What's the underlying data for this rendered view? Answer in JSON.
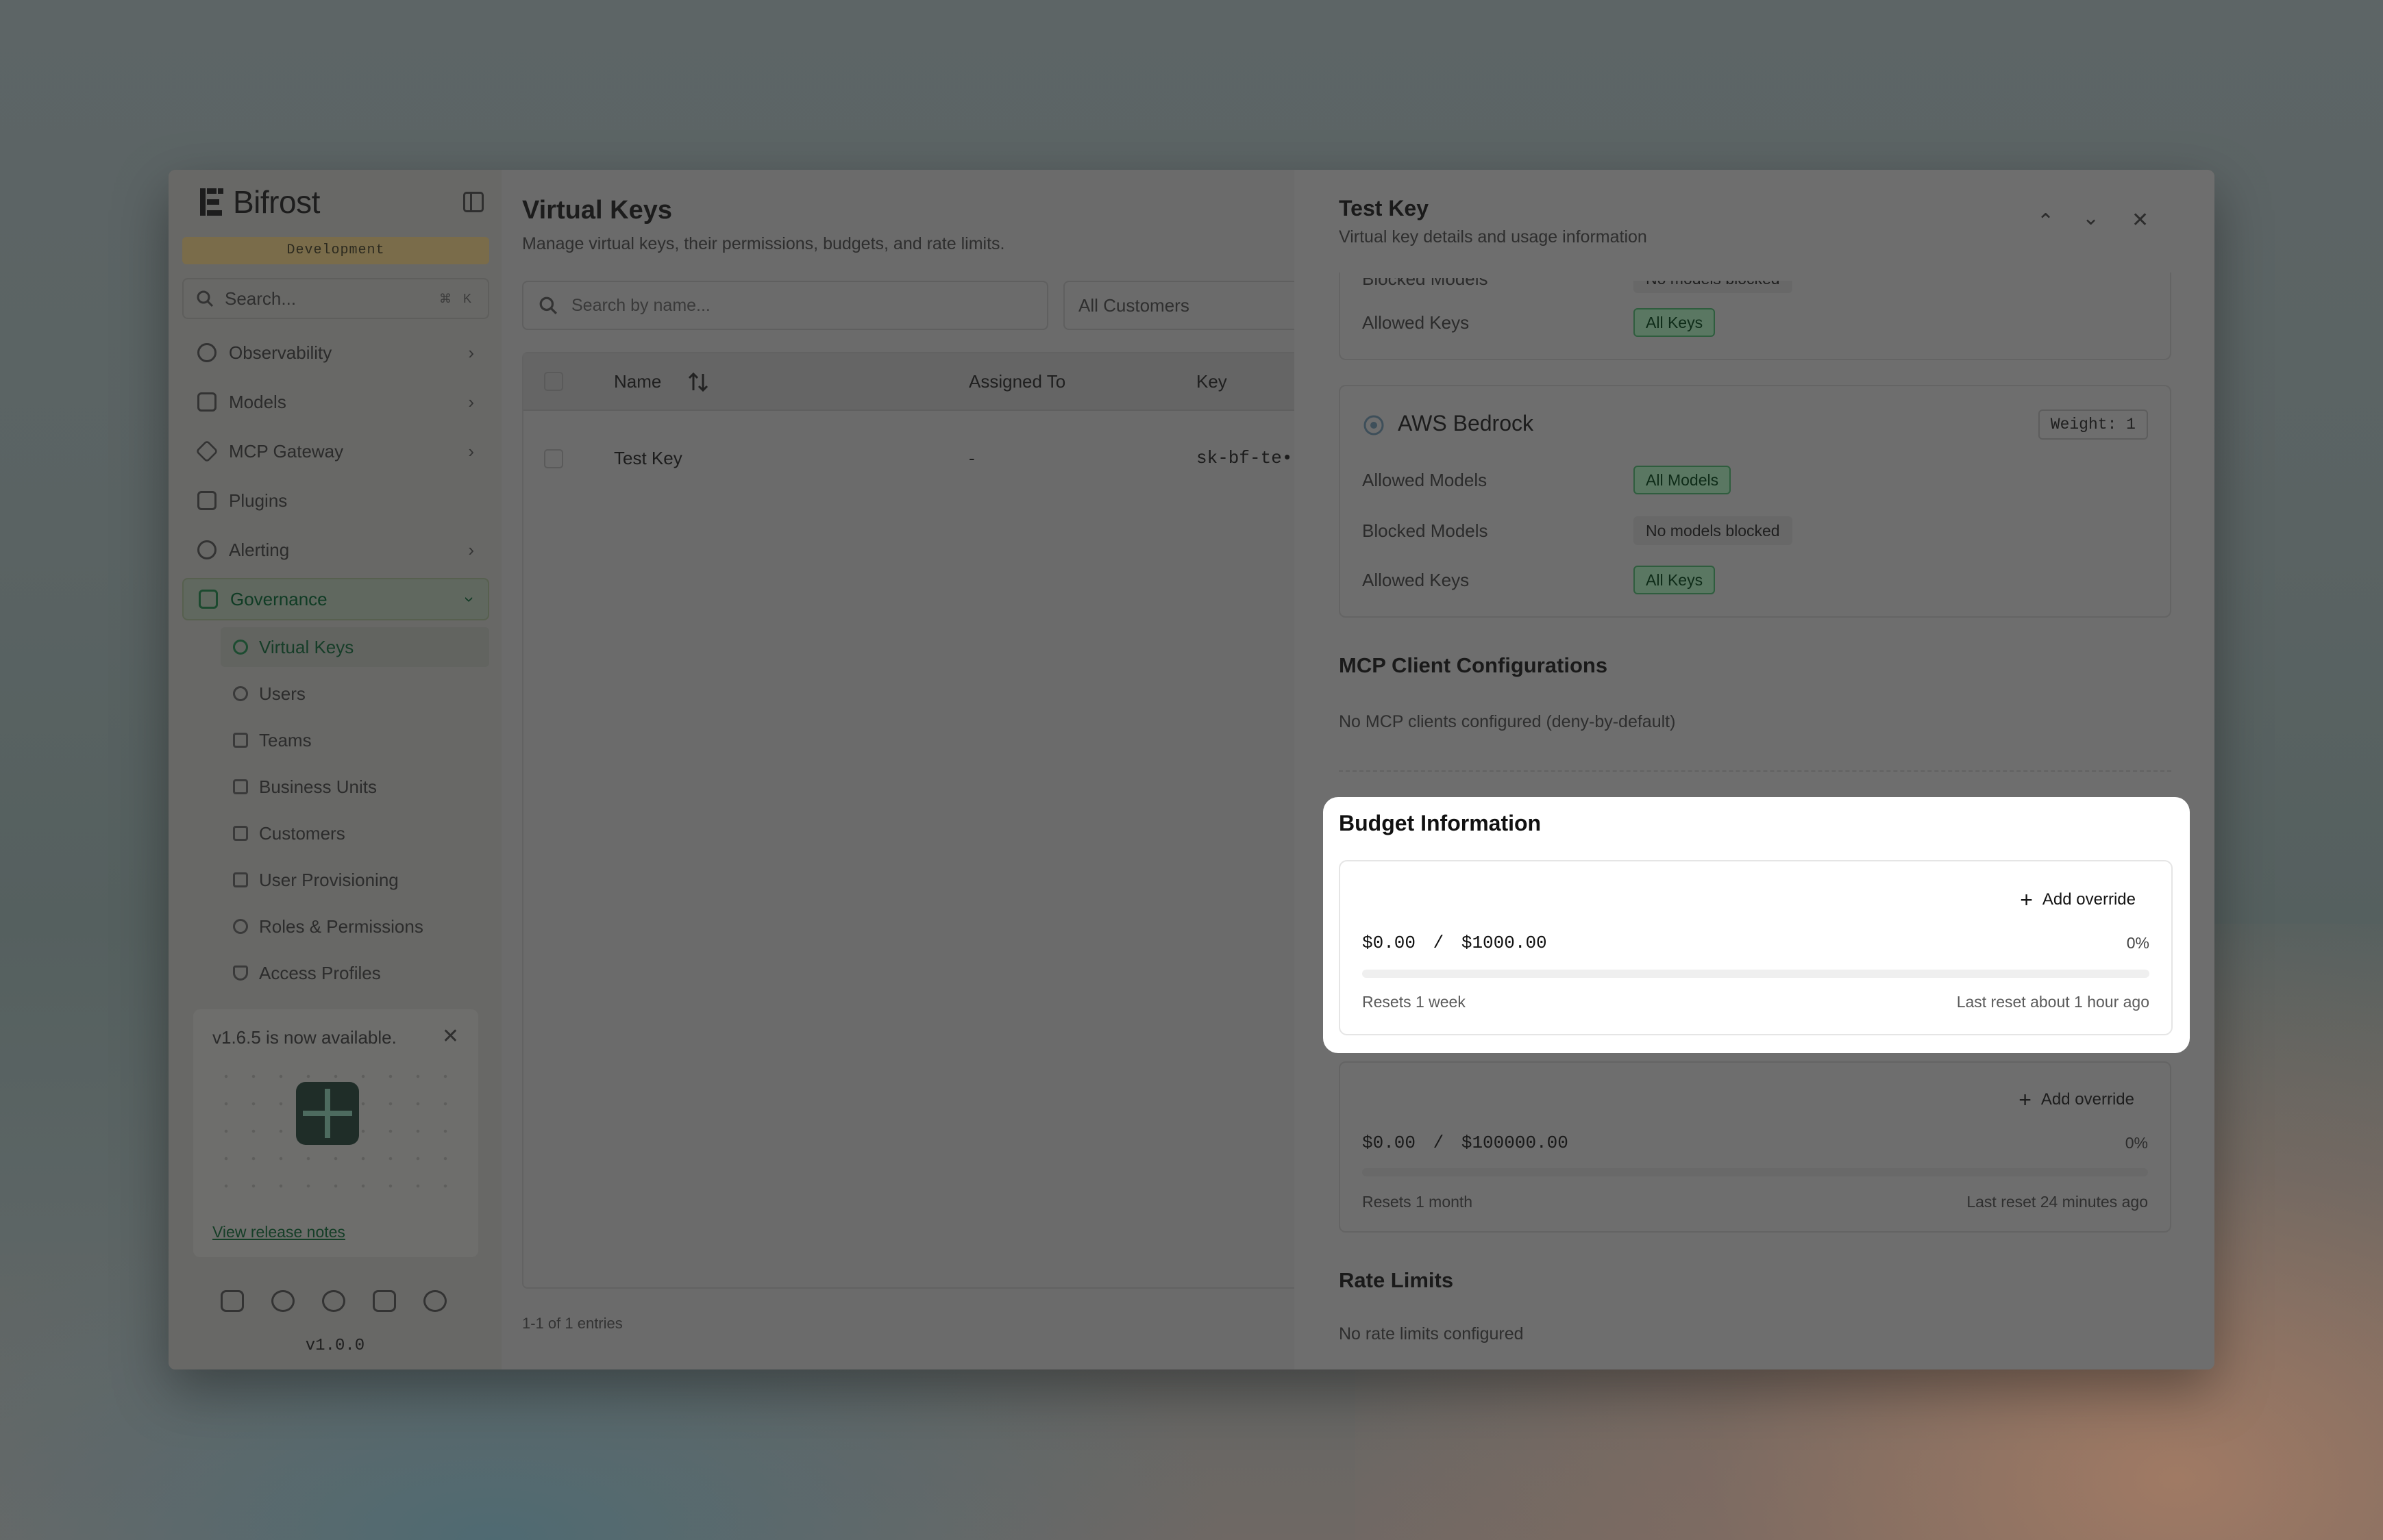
{
  "app": {
    "name": "Bifrost",
    "environment": "Development",
    "version": "v1.0.0"
  },
  "sidebar": {
    "search_placeholder": "Search...",
    "search_shortcut": "⌘ K",
    "items": [
      {
        "label": "Observability",
        "icon": "telescope-icon"
      },
      {
        "label": "Models",
        "icon": "cube-icon"
      },
      {
        "label": "MCP Gateway",
        "icon": "mcp-icon"
      },
      {
        "label": "Plugins",
        "icon": "puzzle-icon"
      },
      {
        "label": "Alerting",
        "icon": "siren-icon"
      },
      {
        "label": "Governance",
        "icon": "landmark-icon"
      }
    ],
    "governance_items": [
      {
        "label": "Virtual Keys",
        "icon": "key-icon"
      },
      {
        "label": "Users",
        "icon": "users-icon"
      },
      {
        "label": "Teams",
        "icon": "teams-icon"
      },
      {
        "label": "Business Units",
        "icon": "building-icon"
      },
      {
        "label": "Customers",
        "icon": "customers-icon"
      },
      {
        "label": "User Provisioning",
        "icon": "provisioning-icon"
      },
      {
        "label": "Roles & Permissions",
        "icon": "roles-icon"
      },
      {
        "label": "Access Profiles",
        "icon": "shield-icon"
      }
    ],
    "update_card": {
      "title": "v1.6.5 is now available.",
      "link": "View release notes"
    }
  },
  "main": {
    "title": "Virtual Keys",
    "subtitle": "Manage virtual keys, their permissions, budgets, and rate limits.",
    "search_placeholder": "Search by name...",
    "customer_filter": "All Customers",
    "columns": {
      "name": "Name",
      "assigned_to": "Assigned To",
      "key": "Key"
    },
    "rows": [
      {
        "name": "Test Key",
        "assigned_to": "-",
        "key": "sk-bf-te•"
      }
    ],
    "entries": "1-1 of 1 entries"
  },
  "drawer": {
    "title": "Test Key",
    "subtitle": "Virtual key details and usage information",
    "top_card": {
      "blocked_models_label": "Blocked Models",
      "blocked_models_value": "No models blocked",
      "allowed_keys_label": "Allowed Keys",
      "allowed_keys_value": "All Keys"
    },
    "provider": {
      "name": "AWS Bedrock",
      "weight": "Weight: 1",
      "allowed_models_label": "Allowed Models",
      "allowed_models_value": "All Models",
      "blocked_models_label": "Blocked Models",
      "blocked_models_value": "No models blocked",
      "allowed_keys_label": "Allowed Keys",
      "allowed_keys_value": "All Keys"
    },
    "mcp": {
      "title": "MCP Client Configurations",
      "text": "No MCP clients configured (deny-by-default)"
    },
    "budget": {
      "title": "Budget Information",
      "budgets": [
        {
          "add_override": "Add override",
          "spent": "$0.00",
          "sep": "/",
          "limit": "$1000.00",
          "percent": "0%",
          "usage_fraction": 0,
          "resets": "Resets 1 week",
          "last_reset": "Last reset about 1 hour ago"
        },
        {
          "add_override": "Add override",
          "spent": "$0.00",
          "sep": "/",
          "limit": "$100000.00",
          "percent": "0%",
          "usage_fraction": 0,
          "resets": "Resets 1 month",
          "last_reset": "Last reset 24 minutes ago"
        }
      ]
    },
    "rate_limits": {
      "title": "Rate Limits",
      "text": "No rate limits configured"
    }
  }
}
